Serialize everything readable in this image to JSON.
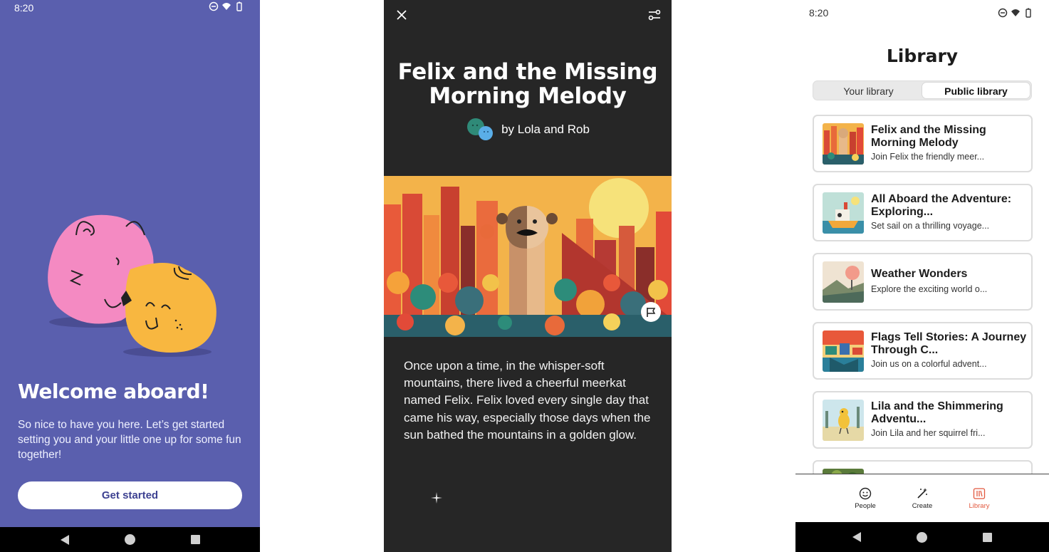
{
  "welcome": {
    "status_time": "8:20",
    "title": "Welcome aboard!",
    "subtitle": "So nice to have you here. Let’s get started setting you and your little one up for some fun together!",
    "cta": "Get started"
  },
  "story": {
    "title": "Felix and the Missing Morning Melody",
    "author": "by Lola and Rob",
    "text": "Once upon a time, in the whisper-soft mountains, there lived a cheerful meerkat named Felix. Felix loved every single day that came his way, especially those days when the sun bathed the mountains in a golden glow."
  },
  "library": {
    "status_time": "8:20",
    "title": "Library",
    "tabs": [
      {
        "label": "Your library",
        "active": false
      },
      {
        "label": "Public library",
        "active": true
      }
    ],
    "books": [
      {
        "title": "Felix and the Missing Morning Melody",
        "desc": "Join Felix the friendly meer..."
      },
      {
        "title": "All Aboard the Adventure: Exploring...",
        "desc": "Set sail on a thrilling voyage..."
      },
      {
        "title": "Weather Wonders",
        "desc": "Explore the exciting world o..."
      },
      {
        "title": "Flags Tell Stories: A Journey Through C...",
        "desc": "Join us on a colorful advent..."
      },
      {
        "title": "Lila and the Shimmering Adventu...",
        "desc": "Join Lila and her squirrel fri..."
      }
    ],
    "bottom_nav": [
      {
        "label": "People",
        "icon": "smiley-icon",
        "active": false
      },
      {
        "label": "Create",
        "icon": "magic-wand-icon",
        "active": false
      },
      {
        "label": "Library",
        "icon": "books-icon",
        "active": true
      }
    ],
    "accent_color": "#e2583e"
  }
}
